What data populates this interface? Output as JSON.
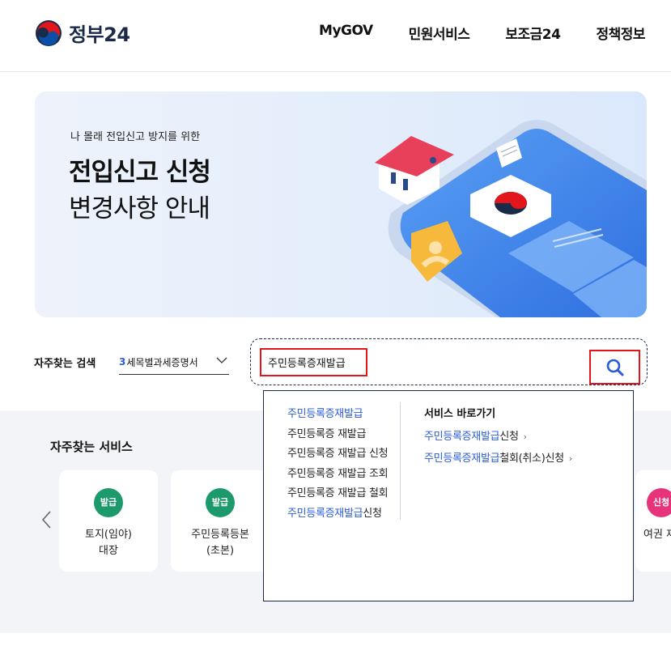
{
  "header": {
    "logo_text": "정부24",
    "nav": [
      "MyGOV",
      "민원서비스",
      "보조금24",
      "정책정보"
    ]
  },
  "banner": {
    "subtitle": "나 몰래 전입신고 방지를 위한",
    "title_line1": "전입신고 신청",
    "title_line2": "변경사항 안내"
  },
  "search": {
    "label": "자주찾는 검색",
    "select_num": "3",
    "select_text": "세목별과세증명서",
    "input_value": "주민등록증재발급",
    "button_icon": "search-icon"
  },
  "suggestions": [
    {
      "hl": "주민등록증재발급",
      "rest": ""
    },
    {
      "hl": "",
      "rest": "주민등록증 재발급"
    },
    {
      "hl": "",
      "rest": "주민등록증 재발급 신청"
    },
    {
      "hl": "",
      "rest": "주민등록증 재발급 조회"
    },
    {
      "hl": "",
      "rest": "주민등록증 재발급 철회"
    },
    {
      "hl": "주민등록증재발급",
      "rest": "신청"
    }
  ],
  "shortcuts": {
    "title": "서비스 바로가기",
    "items": [
      {
        "hl": "주민등록증재발급",
        "rest": "신청",
        "arrow": "›"
      },
      {
        "hl": "주민등록증재발급",
        "rest": "철회(취소)신청",
        "arrow": "›"
      }
    ]
  },
  "services": {
    "title": "자주찾는 서비스",
    "cards": [
      {
        "badge": "발급",
        "name": "토지(임야)\n대장"
      },
      {
        "badge": "발급",
        "name": "주민등록등본\n(초본)"
      },
      {
        "badge": "신청",
        "name": "여권 재"
      }
    ]
  },
  "colors": {
    "accent_blue": "#2a5bd7",
    "badge_green": "#1d9a6c",
    "badge_pink": "#e6337a",
    "highlight_red": "#e3161c"
  }
}
